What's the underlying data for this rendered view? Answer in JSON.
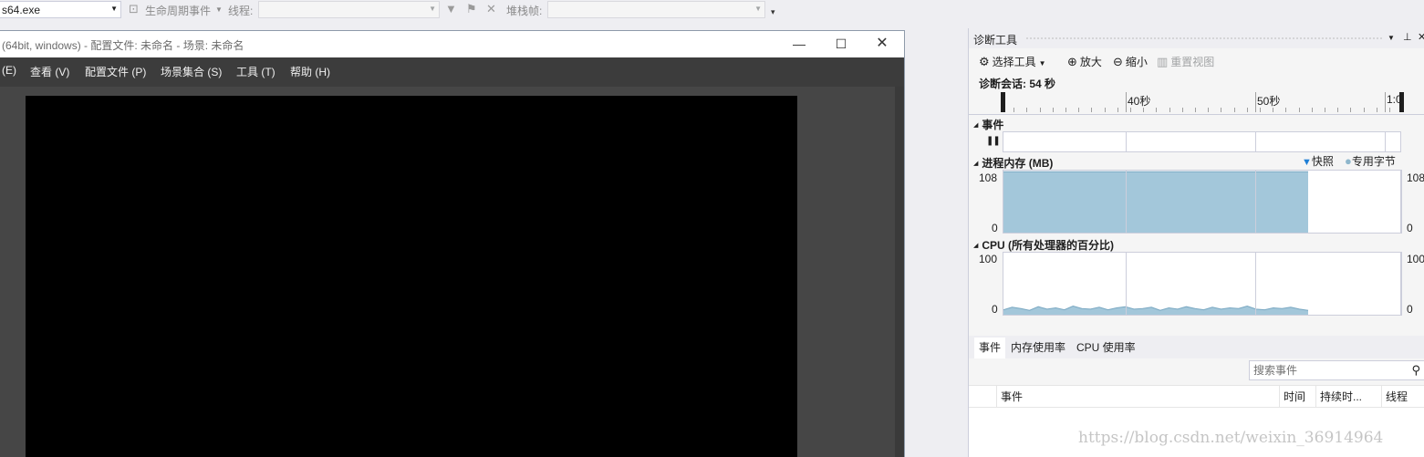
{
  "toolbar": {
    "process_value": "s64.exe",
    "lifecycle_label": "生命周期事件",
    "thread_label": "线程:",
    "stack_label": "堆栈帧:"
  },
  "app_window": {
    "title": "(64bit, windows) - 配置文件: 未命名 - 场景: 未命名",
    "menu": [
      "(E)",
      "查看 (V)",
      "配置文件 (P)",
      "场景集合 (S)",
      "工具 (T)",
      "帮助 (H)"
    ]
  },
  "diagnostics": {
    "title": "诊断工具",
    "tools": {
      "select": "选择工具",
      "zoom_in": "放大",
      "zoom_out": "缩小",
      "reset_view": "重置视图"
    },
    "session": "诊断会话: 54 秒",
    "ruler": [
      "40秒",
      "50秒",
      "1:0"
    ],
    "events_section": "事件",
    "memory_section": "进程内存 (MB)",
    "memory_legend": {
      "snapshot": "快照",
      "private_bytes": "专用字节"
    },
    "cpu_section": "CPU (所有处理器的百分比)",
    "memory_axis": {
      "max": "108",
      "min": "0"
    },
    "cpu_axis": {
      "max": "100",
      "min": "0"
    },
    "tabs": [
      "事件",
      "内存使用率",
      "CPU 使用率"
    ],
    "search_placeholder": "搜索事件",
    "columns": [
      "事件",
      "时间",
      "持续时...",
      "线程"
    ],
    "colors": {
      "memory_fill": "#a3c7da",
      "cpu_fill": "#a3c7da",
      "snapshot_marker": "#1e7fd6"
    }
  },
  "chart_data": [
    {
      "type": "area",
      "title": "进程内存 (MB)",
      "ylim": [
        0,
        108
      ],
      "series": [
        {
          "name": "专用字节",
          "values": [
            106,
            106,
            106,
            106,
            106,
            106,
            106,
            106,
            106,
            106,
            106
          ]
        }
      ]
    },
    {
      "type": "area",
      "title": "CPU (所有处理器的百分比)",
      "ylim": [
        0,
        100
      ],
      "series": [
        {
          "values": [
            8,
            12,
            10,
            7,
            13,
            9,
            11,
            8,
            14,
            10,
            9,
            12,
            8,
            11,
            13,
            9,
            10,
            12,
            7,
            11,
            9,
            13,
            10,
            8,
            12,
            9,
            11,
            10,
            14,
            9,
            8,
            11,
            10,
            12,
            9,
            7
          ]
        }
      ]
    }
  ],
  "watermark": "https://blog.csdn.net/weixin_36914964"
}
